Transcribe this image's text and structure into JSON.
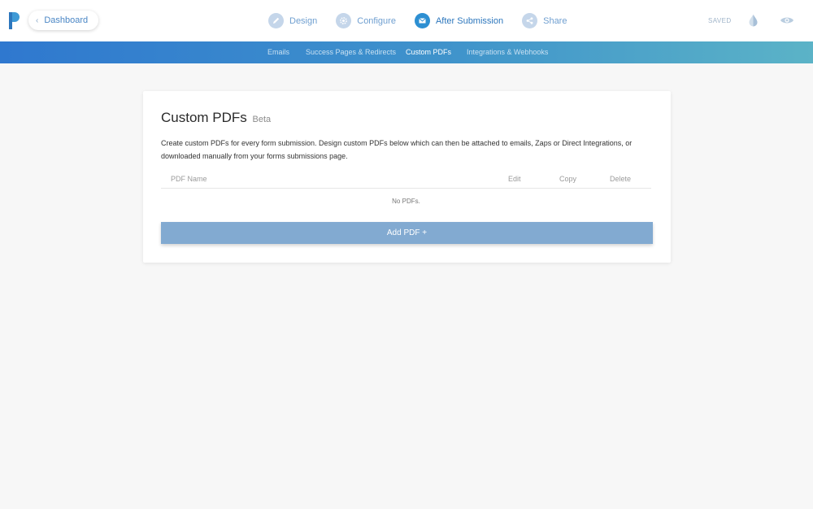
{
  "header": {
    "dashboard_label": "Dashboard",
    "steps": [
      {
        "label": "Design",
        "icon": "pencil-icon"
      },
      {
        "label": "Configure",
        "icon": "gear-icon"
      },
      {
        "label": "After Submission",
        "icon": "envelope-icon",
        "active": true
      },
      {
        "label": "Share",
        "icon": "share-icon"
      }
    ],
    "status": "SAVED",
    "tools": [
      "droplet-icon",
      "eye-icon"
    ]
  },
  "subnav": {
    "items": [
      "Emails",
      "Success Pages & Redirects",
      "Custom PDFs",
      "Integrations & Webhooks"
    ],
    "active": "Custom PDFs"
  },
  "card": {
    "title": "Custom PDFs",
    "badge": "Beta",
    "description": "Create custom PDFs for every form submission. Design custom PDFs below which can then be attached to emails, Zaps or Direct Integrations, or downloaded manually from your forms submissions page.",
    "columns": [
      "PDF Name",
      "Edit",
      "Copy",
      "Delete"
    ],
    "empty_message": "No PDFs.",
    "add_button": "Add PDF +"
  },
  "colors": {
    "accent": "#2d8fd2",
    "subnav_start": "#2f78cf",
    "subnav_end": "#5bb3c7",
    "add_button": "#82aad1"
  }
}
